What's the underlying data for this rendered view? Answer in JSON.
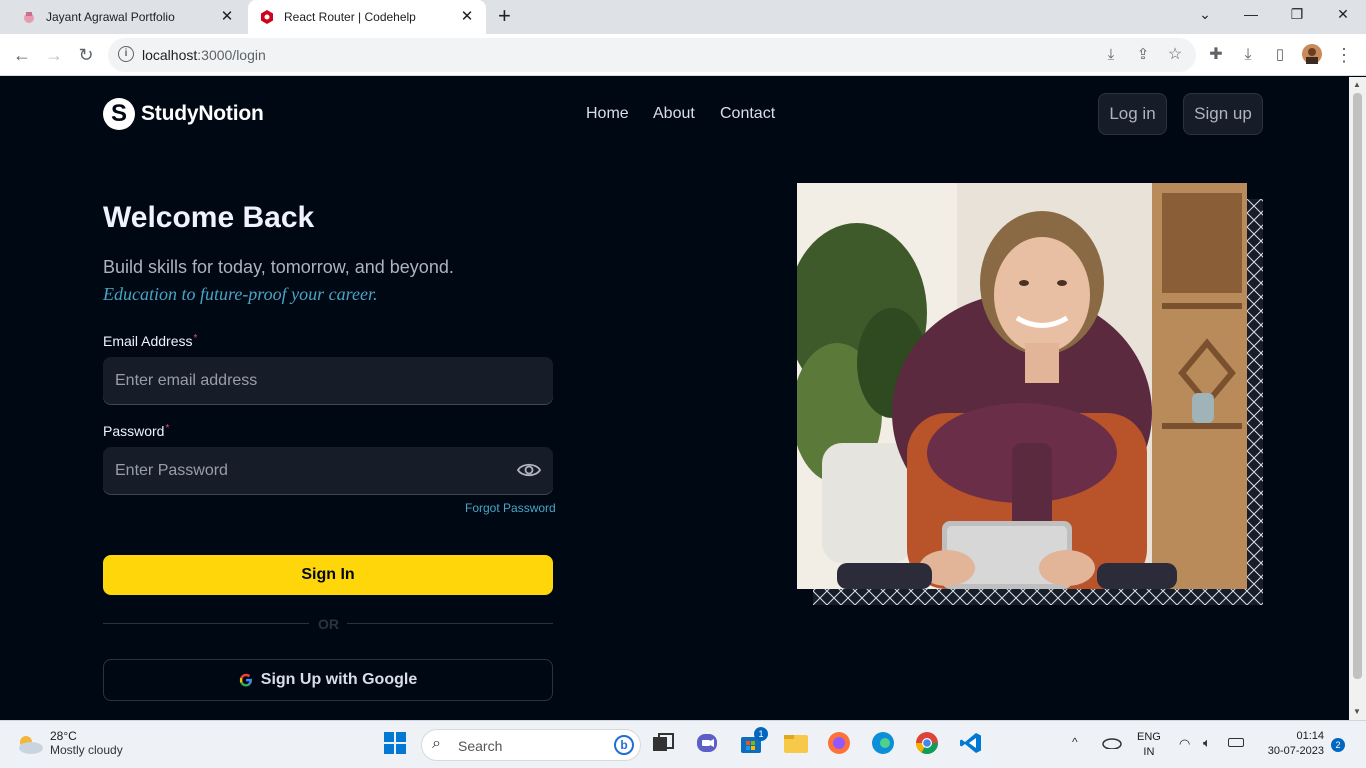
{
  "browser": {
    "tabs": [
      {
        "title": "Jayant Agrawal Portfolio",
        "active": false
      },
      {
        "title": "React Router | Codehelp",
        "active": true
      }
    ],
    "url_host": "localhost",
    "url_path": ":3000/login"
  },
  "navbar": {
    "logo_letter": "S",
    "logo_text": "StudyNotion",
    "links": [
      "Home",
      "About",
      "Contact"
    ],
    "login_label": "Log in",
    "signup_label": "Sign up"
  },
  "login": {
    "heading": "Welcome Back",
    "subtitle": "Build skills for today, tomorrow, and beyond.",
    "tagline": "Education to future-proof your career.",
    "email_label": "Email Address",
    "email_placeholder": "Enter email address",
    "password_label": "Password",
    "password_placeholder": "Enter Password",
    "required_mark": "*",
    "forgot_label": "Forgot Password",
    "signin_label": "Sign In",
    "or_label": "OR",
    "google_label": "Sign Up with Google"
  },
  "colors": {
    "background": "#000814",
    "accent_yellow": "#ffd60a",
    "link_blue": "#47a5c5",
    "input_bg": "#161d29"
  },
  "taskbar": {
    "weather_temp": "28°C",
    "weather_desc": "Mostly cloudy",
    "search_label": "Search",
    "store_badge": "1",
    "lang_line1": "ENG",
    "lang_line2": "IN",
    "time": "01:14",
    "date": "30-07-2023",
    "notification_count": "2"
  }
}
